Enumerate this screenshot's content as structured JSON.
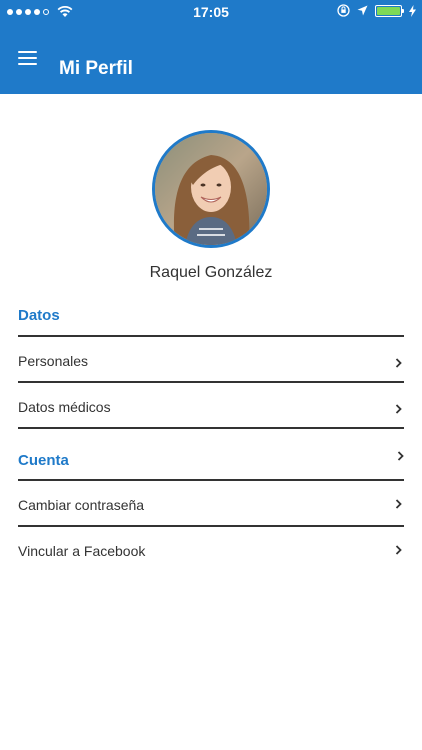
{
  "status_bar": {
    "time": "17:05",
    "battery_level": 1.0
  },
  "nav": {
    "title": "Mi Perfil"
  },
  "profile": {
    "name": "Raquel González"
  },
  "sections": [
    {
      "title": "Datos",
      "items": [
        "Personales",
        "Datos médicos"
      ]
    },
    {
      "title": "Cuenta",
      "items": [
        "Cambiar contraseña",
        "Vincular a Facebook"
      ]
    }
  ],
  "colors": {
    "accent": "#1f7ac9",
    "divider": "#333333",
    "battery": "#7ed957"
  },
  "icons": [
    "menu-icon",
    "wifi-icon",
    "location-arrow-icon",
    "rotation-lock-icon",
    "battery-icon",
    "chevron-right-icon"
  ]
}
